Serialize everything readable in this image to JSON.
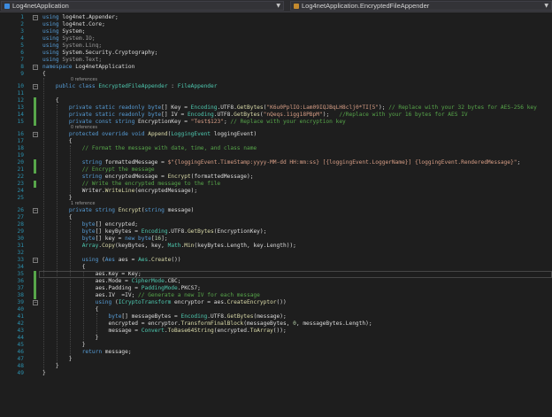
{
  "navbar": {
    "project": "Log4netApplication",
    "member": "Log4netApplication.EncryptedFileAppender"
  },
  "editor": {
    "lines": [
      {
        "n": "1",
        "tokens": [
          [
            "kw",
            "using"
          ],
          [
            "txt",
            " log4net.Appender;"
          ]
        ]
      },
      {
        "n": "2",
        "tokens": [
          [
            "kw",
            "using"
          ],
          [
            "txt",
            " log4net.Core;"
          ]
        ]
      },
      {
        "n": "3",
        "tokens": [
          [
            "kw",
            "using"
          ],
          [
            "txt",
            " System;"
          ]
        ]
      },
      {
        "n": "4",
        "tokens": [
          [
            "kw",
            "using"
          ],
          [
            "using",
            " System.IO;"
          ]
        ]
      },
      {
        "n": "5",
        "tokens": [
          [
            "kw",
            "using"
          ],
          [
            "using",
            " System.Linq;"
          ]
        ]
      },
      {
        "n": "6",
        "tokens": [
          [
            "kw",
            "using"
          ],
          [
            "txt",
            " System.Security.Cryptography;"
          ]
        ]
      },
      {
        "n": "7",
        "tokens": [
          [
            "kw",
            "using"
          ],
          [
            "using",
            " System.Text;"
          ]
        ]
      },
      {
        "n": "8",
        "tokens": [
          [
            "kw",
            "namespace"
          ],
          [
            "txt",
            " Log4netApplication"
          ]
        ]
      },
      {
        "n": "9",
        "tokens": [
          [
            "txt",
            "{"
          ]
        ]
      },
      {
        "ref": "0 references"
      },
      {
        "n": "10",
        "tokens": [
          [
            "txt",
            "    "
          ],
          [
            "kw",
            "public class"
          ],
          [
            "txt",
            " "
          ],
          [
            "type",
            "EncryptedFileAppender"
          ],
          [
            "txt",
            " : "
          ],
          [
            "type",
            "FileAppender"
          ]
        ]
      },
      {
        "n": "11",
        "tokens": []
      },
      {
        "n": "12",
        "tokens": [
          [
            "txt",
            "    {"
          ]
        ]
      },
      {
        "n": "13",
        "tokens": [
          [
            "txt",
            "        "
          ],
          [
            "kw",
            "private static readonly byte"
          ],
          [
            "txt",
            "[] Key = "
          ],
          [
            "type",
            "Encoding"
          ],
          [
            "txt",
            ".UTF8."
          ],
          [
            "meth",
            "GetBytes"
          ],
          [
            "txt",
            "("
          ],
          [
            "str",
            "\"K6u0PplIO:Lam09IQJBqLH8clj0*TI[5\""
          ],
          [
            "txt",
            "); "
          ],
          [
            "com",
            "// Replace with your 32 bytes for AES-256 key"
          ]
        ]
      },
      {
        "n": "14",
        "tokens": [
          [
            "txt",
            "        "
          ],
          [
            "kw",
            "private static readonly byte"
          ],
          [
            "txt",
            "[] IV = "
          ],
          [
            "type",
            "Encoding"
          ],
          [
            "txt",
            ".UTF8."
          ],
          [
            "meth",
            "GetBytes"
          ],
          [
            "txt",
            "("
          ],
          [
            "str",
            "\"nQeqs.1igg18PBpM\""
          ],
          [
            "txt",
            ");   "
          ],
          [
            "com",
            "//Replace with your 16 bytes for AES IV"
          ]
        ]
      },
      {
        "n": "15",
        "tokens": [
          [
            "txt",
            "        "
          ],
          [
            "kw",
            "private const string"
          ],
          [
            "txt",
            " EncryptionKey = "
          ],
          [
            "str",
            "\"Test$123\""
          ],
          [
            "txt",
            "; "
          ],
          [
            "com",
            "// Replace with your encryption key"
          ]
        ]
      },
      {
        "ref": "0 references"
      },
      {
        "n": "16",
        "tokens": [
          [
            "txt",
            "        "
          ],
          [
            "kw",
            "protected override void"
          ],
          [
            "txt",
            " "
          ],
          [
            "meth",
            "Append"
          ],
          [
            "txt",
            "("
          ],
          [
            "type",
            "LoggingEvent"
          ],
          [
            "txt",
            " loggingEvent)"
          ]
        ]
      },
      {
        "n": "17",
        "tokens": [
          [
            "txt",
            "        {"
          ]
        ]
      },
      {
        "n": "18",
        "tokens": [
          [
            "txt",
            "            "
          ],
          [
            "com",
            "// Format the message with date, time, and class name"
          ]
        ]
      },
      {
        "n": "19",
        "tokens": []
      },
      {
        "n": "20",
        "tokens": [
          [
            "txt",
            "            "
          ],
          [
            "kw",
            "string"
          ],
          [
            "txt",
            " formattedMessage = "
          ],
          [
            "str",
            "$\"{loggingEvent.TimeStamp:yyyy-MM-dd HH:mm:ss} [{loggingEvent.LoggerName}] {loggingEvent.RenderedMessage}\""
          ],
          [
            "txt",
            ";"
          ]
        ]
      },
      {
        "n": "21",
        "tokens": [
          [
            "txt",
            "            "
          ],
          [
            "com",
            "// Encrypt the message"
          ]
        ]
      },
      {
        "n": "22",
        "tokens": [
          [
            "txt",
            "            "
          ],
          [
            "kw",
            "string"
          ],
          [
            "txt",
            " encryptedMessage = "
          ],
          [
            "meth",
            "Encrypt"
          ],
          [
            "txt",
            "(formattedMessage);"
          ]
        ]
      },
      {
        "n": "23",
        "tokens": [
          [
            "txt",
            "            "
          ],
          [
            "com",
            "// Write the encrypted message to the file"
          ]
        ]
      },
      {
        "n": "24",
        "tokens": [
          [
            "txt",
            "            Writer."
          ],
          [
            "meth",
            "WriteLine"
          ],
          [
            "txt",
            "(encryptedMessage);"
          ]
        ]
      },
      {
        "n": "25",
        "tokens": [
          [
            "txt",
            "        }"
          ]
        ]
      },
      {
        "ref": "1 reference"
      },
      {
        "n": "26",
        "tokens": [
          [
            "txt",
            "        "
          ],
          [
            "kw",
            "private string"
          ],
          [
            "txt",
            " "
          ],
          [
            "meth",
            "Encrypt"
          ],
          [
            "txt",
            "("
          ],
          [
            "kw",
            "string"
          ],
          [
            "txt",
            " message)"
          ]
        ]
      },
      {
        "n": "27",
        "tokens": [
          [
            "txt",
            "        {"
          ]
        ]
      },
      {
        "n": "28",
        "tokens": [
          [
            "txt",
            "            "
          ],
          [
            "kw",
            "byte"
          ],
          [
            "txt",
            "[] encrypted;"
          ]
        ]
      },
      {
        "n": "29",
        "tokens": [
          [
            "txt",
            "            "
          ],
          [
            "kw",
            "byte"
          ],
          [
            "txt",
            "[] keyBytes = "
          ],
          [
            "type",
            "Encoding"
          ],
          [
            "txt",
            ".UTF8."
          ],
          [
            "meth",
            "GetBytes"
          ],
          [
            "txt",
            "(EncryptionKey);"
          ]
        ]
      },
      {
        "n": "30",
        "tokens": [
          [
            "txt",
            "            "
          ],
          [
            "kw",
            "byte"
          ],
          [
            "txt",
            "[] key = "
          ],
          [
            "kw",
            "new byte"
          ],
          [
            "txt",
            "["
          ],
          [
            "num",
            "16"
          ],
          [
            "txt",
            "];"
          ]
        ]
      },
      {
        "n": "31",
        "tokens": [
          [
            "txt",
            "            "
          ],
          [
            "type",
            "Array"
          ],
          [
            "txt",
            "."
          ],
          [
            "meth",
            "Copy"
          ],
          [
            "txt",
            "(keyBytes, key, "
          ],
          [
            "type",
            "Math"
          ],
          [
            "txt",
            "."
          ],
          [
            "meth",
            "Min"
          ],
          [
            "txt",
            "(keyBytes.Length, key.Length));"
          ]
        ]
      },
      {
        "n": "32",
        "tokens": []
      },
      {
        "n": "33",
        "tokens": [
          [
            "txt",
            "            "
          ],
          [
            "kw",
            "using"
          ],
          [
            "txt",
            " ("
          ],
          [
            "kw",
            "Aes"
          ],
          [
            "txt",
            " aes = "
          ],
          [
            "type",
            "Aes"
          ],
          [
            "txt",
            "."
          ],
          [
            "meth",
            "Create"
          ],
          [
            "txt",
            "())"
          ]
        ]
      },
      {
        "n": "34",
        "tokens": [
          [
            "txt",
            "            {"
          ]
        ]
      },
      {
        "n": "35",
        "tokens": [
          [
            "txt",
            "                aes.Key = Key;"
          ]
        ]
      },
      {
        "n": "36",
        "tokens": [
          [
            "txt",
            "                aes.Mode = "
          ],
          [
            "type",
            "CipherMode"
          ],
          [
            "txt",
            ".CBC;"
          ]
        ]
      },
      {
        "n": "37",
        "tokens": [
          [
            "txt",
            "                aes.Padding = "
          ],
          [
            "type",
            "PaddingMode"
          ],
          [
            "txt",
            ".PKCS7;"
          ]
        ]
      },
      {
        "n": "38",
        "tokens": [
          [
            "txt",
            "                aes.IV  =IV; "
          ],
          [
            "com",
            "// Generate a new IV for each message"
          ]
        ]
      },
      {
        "n": "39",
        "tokens": [
          [
            "txt",
            "                "
          ],
          [
            "kw",
            "using"
          ],
          [
            "txt",
            " ("
          ],
          [
            "type",
            "ICryptoTransform"
          ],
          [
            "txt",
            " encryptor = aes."
          ],
          [
            "meth",
            "CreateEncryptor"
          ],
          [
            "txt",
            "())"
          ]
        ]
      },
      {
        "n": "40",
        "tokens": [
          [
            "txt",
            "                {"
          ]
        ]
      },
      {
        "n": "41",
        "tokens": [
          [
            "txt",
            "                    "
          ],
          [
            "kw",
            "byte"
          ],
          [
            "txt",
            "[] messageBytes = "
          ],
          [
            "type",
            "Encoding"
          ],
          [
            "txt",
            ".UTF8."
          ],
          [
            "meth",
            "GetBytes"
          ],
          [
            "txt",
            "(message);"
          ]
        ]
      },
      {
        "n": "42",
        "tokens": [
          [
            "txt",
            "                    encrypted = encryptor."
          ],
          [
            "meth",
            "TransformFinalBlock"
          ],
          [
            "txt",
            "(messageBytes, "
          ],
          [
            "num",
            "0"
          ],
          [
            "txt",
            ", messageBytes.Length);"
          ]
        ]
      },
      {
        "n": "43",
        "tokens": [
          [
            "txt",
            "                    message = "
          ],
          [
            "type",
            "Convert"
          ],
          [
            "txt",
            "."
          ],
          [
            "meth",
            "ToBase64String"
          ],
          [
            "txt",
            "(encrypted."
          ],
          [
            "meth",
            "ToArray"
          ],
          [
            "txt",
            "());"
          ]
        ]
      },
      {
        "n": "44",
        "tokens": [
          [
            "txt",
            "                }"
          ]
        ]
      },
      {
        "n": "45",
        "tokens": [
          [
            "txt",
            "            }"
          ]
        ]
      },
      {
        "n": "46",
        "tokens": [
          [
            "txt",
            "            "
          ],
          [
            "kw",
            "return"
          ],
          [
            "txt",
            " message;"
          ]
        ]
      },
      {
        "n": "47",
        "tokens": [
          [
            "txt",
            "        }"
          ]
        ]
      },
      {
        "n": "48",
        "tokens": [
          [
            "txt",
            "    }"
          ]
        ]
      },
      {
        "n": "49",
        "tokens": [
          [
            "txt",
            "}"
          ]
        ]
      }
    ]
  },
  "icons": {
    "project_icon": "project-csharp-icon",
    "class_icon": "class-icon",
    "dropdown_icon": "chevron-down-icon",
    "collapse_icon": "fold-minus-icon"
  }
}
